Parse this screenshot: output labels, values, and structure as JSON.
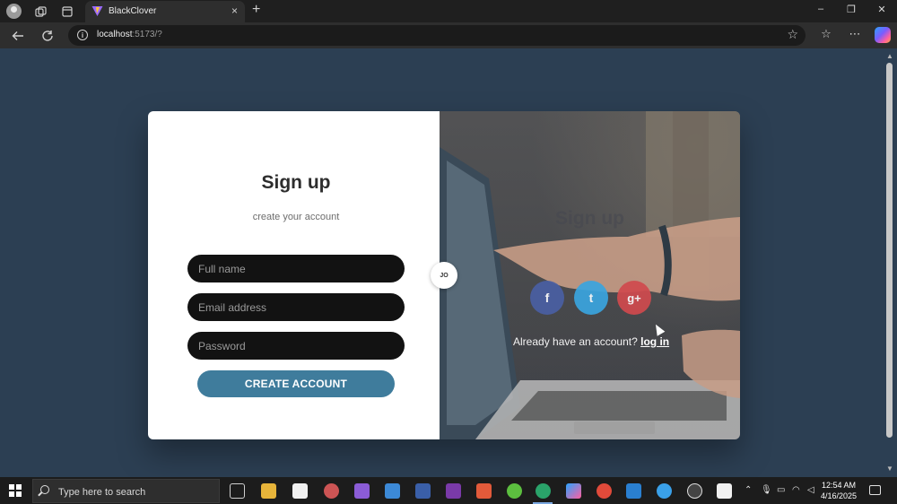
{
  "browser": {
    "tab_title": "BlackClover",
    "tab_close": "×",
    "new_tab": "+",
    "url_host": "localhost",
    "url_path": ":5173/?",
    "window_controls": {
      "minimize": "–",
      "maximize": "❐",
      "close": "✕"
    }
  },
  "signup": {
    "title": "Sign up",
    "subtitle": "create your account",
    "full_name_placeholder": "Full name",
    "email_placeholder": "Email address",
    "password_placeholder": "Password",
    "create_label": "CREATE ACCOUNT"
  },
  "overlay": {
    "ghost_title": "Sign up",
    "avatar_initials": "JO",
    "social": {
      "facebook": "f",
      "twitter": "t",
      "google": "g+"
    },
    "already_text": "Already have an account? ",
    "login_label": "log in"
  },
  "taskbar": {
    "search_placeholder": "Type here to search",
    "time": "12:54 AM",
    "date": "4/16/2025"
  },
  "colors": {
    "page_bg": "#2c3f53",
    "create_button": "#3f7c9c",
    "facebook": "#4a5fa3",
    "twitter": "#3aa5df",
    "google": "#d04a4e"
  }
}
